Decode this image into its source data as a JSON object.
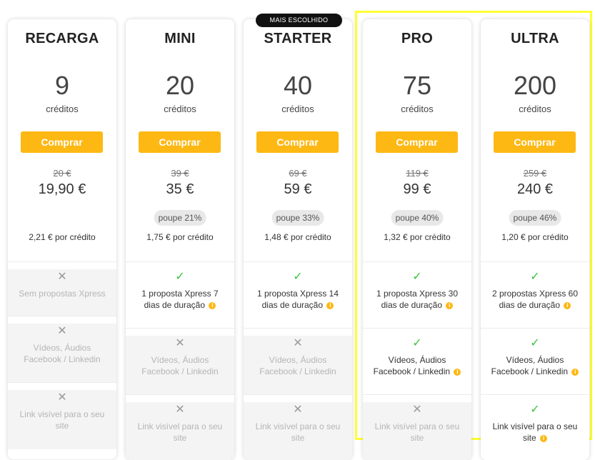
{
  "badge": "MAIS ESCOLHIDO",
  "buy_label": "Comprar",
  "plans": [
    {
      "name": "RECARGA",
      "credits": "9",
      "credits_label": "créditos",
      "old_price": "20 €",
      "price": "19,90 €",
      "savings": "",
      "per_credit": "2,21 € por crédito",
      "features": [
        {
          "icon": "x-icon",
          "text": "Sem propostas Xpress"
        },
        {
          "icon": "x-icon",
          "text": "Vídeos, Áudios Facebook / Linkedin"
        },
        {
          "icon": "x-icon",
          "text": "Link visível para o seu site"
        }
      ]
    },
    {
      "name": "MINI",
      "credits": "20",
      "credits_label": "créditos",
      "old_price": "39 €",
      "price": "35 €",
      "savings": "poupe 21%",
      "per_credit": "1,75 € por crédito",
      "features": [
        {
          "icon": "check-icon",
          "text": "1 proposta Xpress 7 dias de duração"
        },
        {
          "icon": "x-icon",
          "text": "Vídeos, Áudios Facebook / Linkedin"
        },
        {
          "icon": "x-icon",
          "text": "Link visível para o seu site"
        }
      ]
    },
    {
      "name": "STARTER",
      "credits": "40",
      "credits_label": "créditos",
      "old_price": "69 €",
      "price": "59 €",
      "savings": "poupe 33%",
      "per_credit": "1,48 € por crédito",
      "features": [
        {
          "icon": "check-icon",
          "text": "1 proposta Xpress 14 dias de duração"
        },
        {
          "icon": "x-icon",
          "text": "Vídeos, Áudios Facebook / Linkedin"
        },
        {
          "icon": "x-icon",
          "text": "Link visível para o seu site"
        }
      ]
    },
    {
      "name": "PRO",
      "credits": "75",
      "credits_label": "créditos",
      "old_price": "119 €",
      "price": "99 €",
      "savings": "poupe 40%",
      "per_credit": "1,32 € por crédito",
      "features": [
        {
          "icon": "check-icon",
          "text": "1 proposta Xpress 30 dias de duração"
        },
        {
          "icon": "check-icon",
          "text": "Vídeos, Áudios Facebook / Linkedin"
        },
        {
          "icon": "x-icon",
          "text": "Link visível para o seu site"
        }
      ]
    },
    {
      "name": "ULTRA",
      "credits": "200",
      "credits_label": "créditos",
      "old_price": "259 €",
      "price": "240 €",
      "savings": "poupe 46%",
      "per_credit": "1,20 € por crédito",
      "features": [
        {
          "icon": "check-icon",
          "text": "2 propostas Xpress 60 dias de duração"
        },
        {
          "icon": "check-icon",
          "text": "Vídeos, Áudios Facebook / Linkedin"
        },
        {
          "icon": "check-icon",
          "text": "Link visível para o seu site"
        }
      ]
    }
  ],
  "colors": {
    "accent": "#fdb813",
    "check": "#3cc23c",
    "highlight": "#ffff33"
  }
}
